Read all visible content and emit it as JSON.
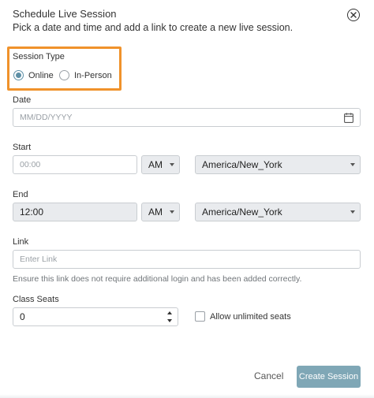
{
  "dialog": {
    "title": "Schedule Live Session",
    "subtitle": "Pick a date and time and add a link to create a new live session."
  },
  "session_type": {
    "label": "Session Type",
    "options": [
      {
        "label": "Online",
        "selected": true
      },
      {
        "label": "In-Person",
        "selected": false
      }
    ]
  },
  "date": {
    "label": "Date",
    "placeholder": "MM/DD/YYYY",
    "icon": "calendar-icon"
  },
  "start": {
    "label": "Start",
    "time_placeholder": "00:00",
    "meridiem": "AM",
    "timezone": "America/New_York"
  },
  "end": {
    "label": "End",
    "time_value": "12:00",
    "meridiem": "AM",
    "timezone": "America/New_York"
  },
  "link": {
    "label": "Link",
    "placeholder": "Enter Link",
    "helper": "Ensure this link does not require additional login and has been added correctly."
  },
  "class_seats": {
    "label": "Class Seats",
    "value": "0",
    "unlimited_label": "Allow unlimited seats",
    "unlimited_checked": false
  },
  "actions": {
    "cancel_label": "Cancel",
    "create_label": "Create Session"
  },
  "colors": {
    "highlight_border": "#f0922b",
    "primary_button": "#7fa7b6",
    "radio_accent": "#5d8fa6"
  }
}
